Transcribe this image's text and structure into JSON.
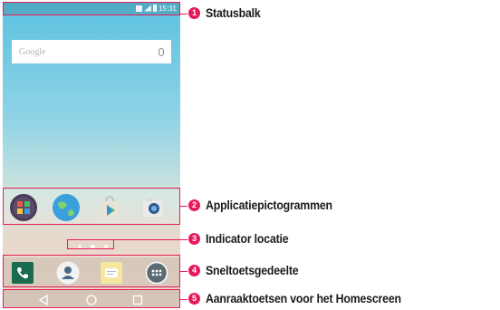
{
  "statusbar": {
    "time": "15:31"
  },
  "search": {
    "label": "Google"
  },
  "apps": [
    {
      "name": "folder-app",
      "color": "#5b4a6a"
    },
    {
      "name": "browser-app",
      "color": "#3aa0dc"
    },
    {
      "name": "play-store-app",
      "color": "#e9e2d6"
    },
    {
      "name": "camera-app",
      "color": "#eaeaea"
    }
  ],
  "dock": [
    {
      "name": "phone-app",
      "color": "#1b6b4e"
    },
    {
      "name": "contacts-app",
      "color": "#f2f2f2"
    },
    {
      "name": "messaging-app",
      "color": "#f6e6a0"
    },
    {
      "name": "apps-drawer",
      "color": "#5c6a72"
    }
  ],
  "callouts": [
    {
      "num": "1",
      "label": "Statusbalk"
    },
    {
      "num": "2",
      "label": "Applicatiepictogrammen"
    },
    {
      "num": "3",
      "label": "Indicator locatie"
    },
    {
      "num": "4",
      "label": "Sneltoetsgedeelte"
    },
    {
      "num": "5",
      "label": "Aanraaktoetsen voor het Homescreen"
    }
  ],
  "accent": "#e81b5a"
}
